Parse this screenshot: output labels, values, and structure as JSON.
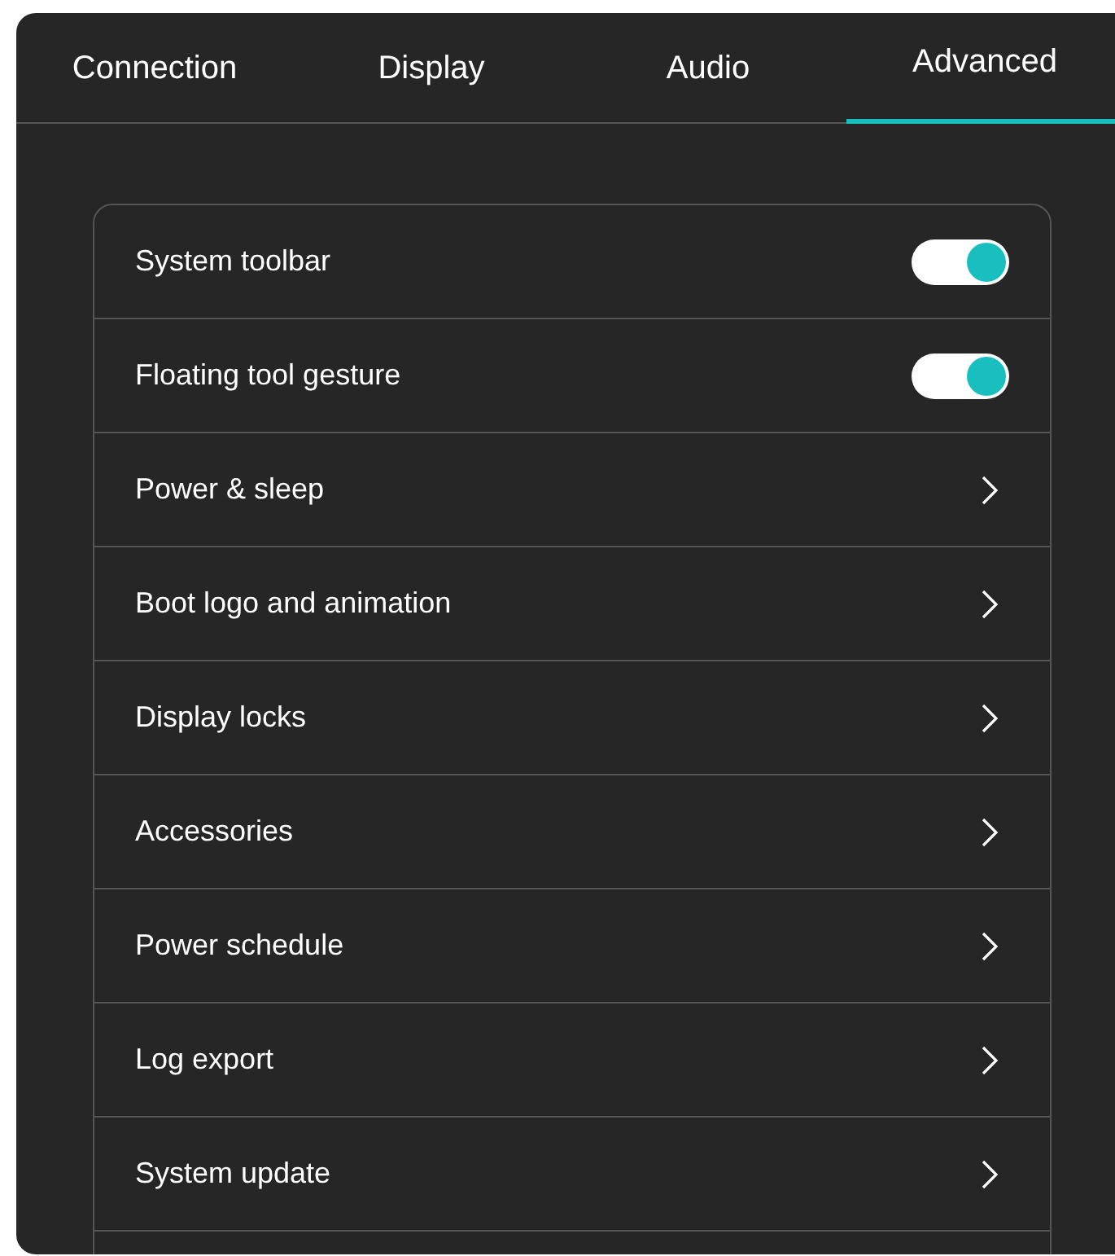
{
  "tabs": [
    {
      "label": "Connection",
      "selected": false
    },
    {
      "label": "Display",
      "selected": false
    },
    {
      "label": "Audio",
      "selected": false
    },
    {
      "label": "Advanced",
      "selected": true
    }
  ],
  "settings": [
    {
      "kind": "toggle",
      "label": "System toolbar",
      "on": true
    },
    {
      "kind": "toggle",
      "label": "Floating tool gesture",
      "on": true
    },
    {
      "kind": "link",
      "label": "Power & sleep"
    },
    {
      "kind": "link",
      "label": "Boot logo and animation"
    },
    {
      "kind": "link",
      "label": "Display locks"
    },
    {
      "kind": "link",
      "label": "Accessories"
    },
    {
      "kind": "link",
      "label": "Power schedule"
    },
    {
      "kind": "link",
      "label": "Log export"
    },
    {
      "kind": "link",
      "label": "System update"
    }
  ]
}
